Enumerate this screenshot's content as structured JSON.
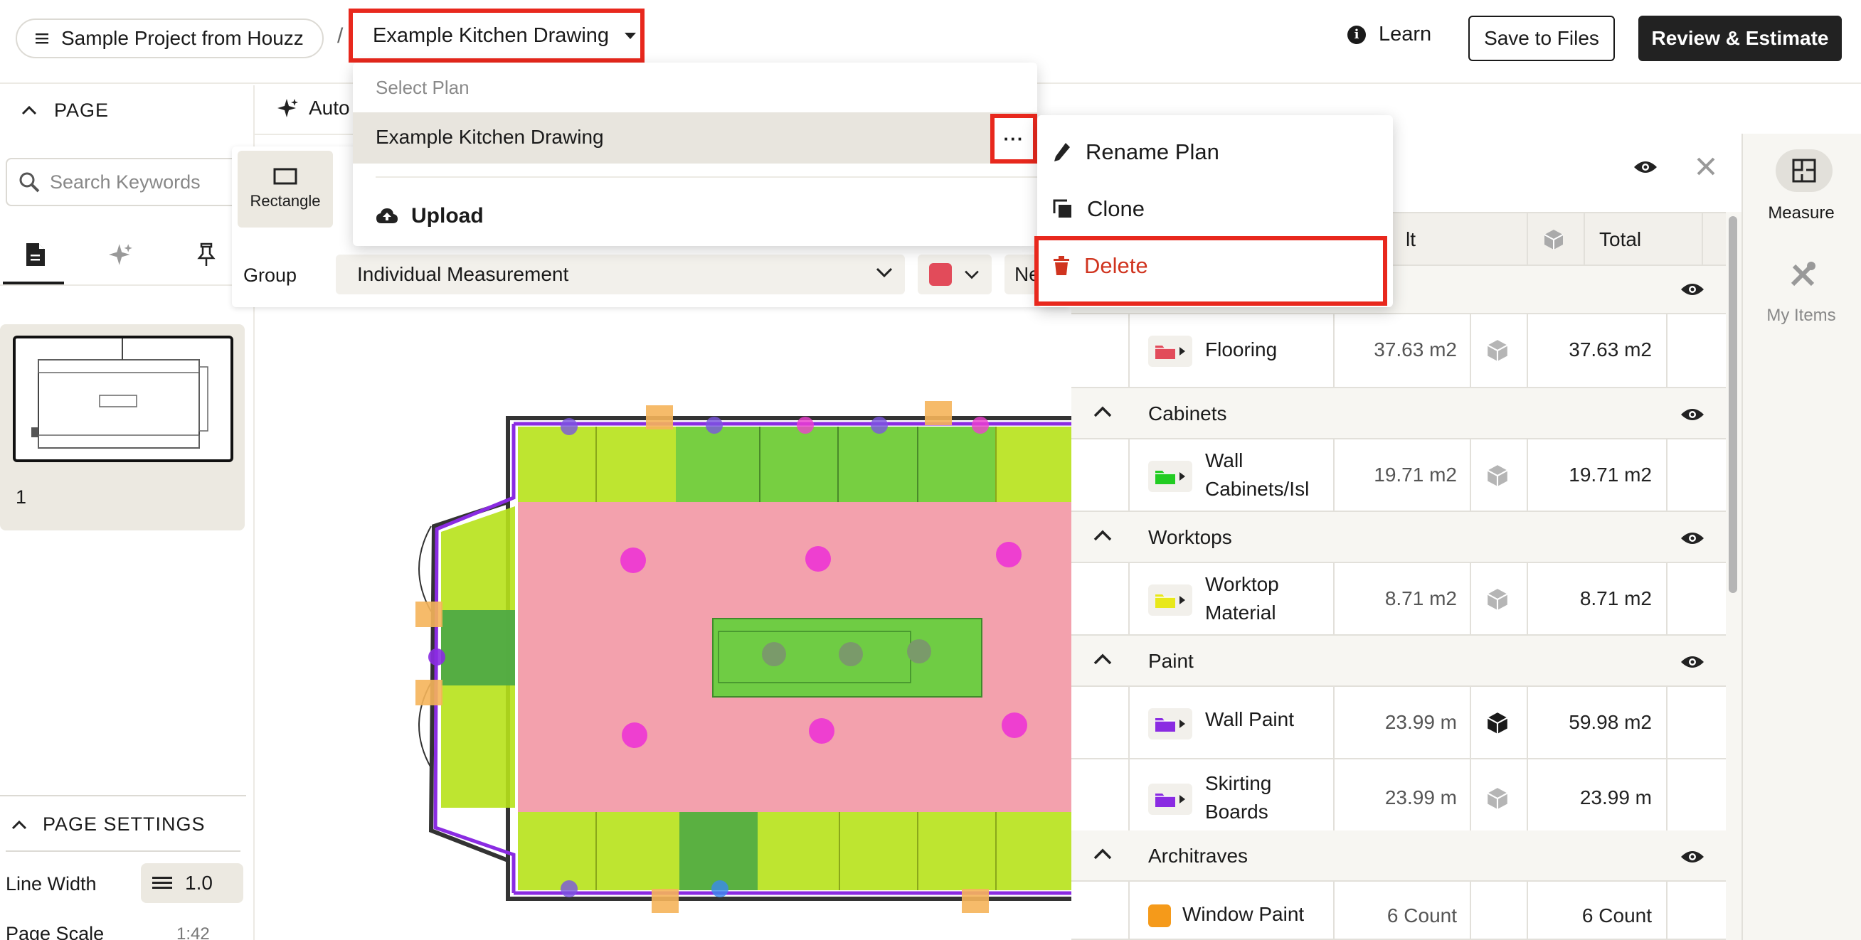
{
  "breadcrumb": {
    "project_label": "Sample Project from Houzz",
    "separator": "/",
    "plan_label": "Example Kitchen Drawing"
  },
  "header": {
    "learn_label": "Learn",
    "save_label": "Save to Files",
    "review_label": "Review & Estimate"
  },
  "page_section": {
    "title": "PAGE",
    "auto_tab_label": "Auto"
  },
  "sidebar": {
    "search_placeholder": "Search Keywords",
    "page_number": "1",
    "settings_title": "PAGE SETTINGS",
    "line_width_label": "Line Width",
    "line_width_value": "1.0",
    "page_scale_label": "Page Scale",
    "page_scale_value": "1:42"
  },
  "toolbar": {
    "rectangle_label": "Rectangle",
    "group_label": "Group",
    "group_value": "Individual Measurement",
    "group_color": "#e24b5a",
    "next_select_partial": "Ne"
  },
  "plan_dropdown": {
    "title": "Select Plan",
    "items": [
      "Example Kitchen Drawing"
    ],
    "more_label": "···",
    "upload_label": "Upload"
  },
  "context_menu": {
    "rename_label": "Rename Plan",
    "clone_label": "Clone",
    "delete_label": "Delete",
    "delete_color": "#d0341f"
  },
  "measure_panel": {
    "header_partial": "lt",
    "total_header": "Total",
    "groups": [
      {
        "name": "",
        "items": [
          {
            "name": "Flooring",
            "value": "37.63 m2",
            "total": "37.63 m2",
            "folder_color": "#e24b5a",
            "cube_active": false
          }
        ]
      },
      {
        "name": "Cabinets",
        "items": [
          {
            "name": "Wall Cabinets/Isl",
            "value": "19.71 m2",
            "total": "19.71 m2",
            "folder_color": "#22cc22",
            "cube_active": false
          }
        ]
      },
      {
        "name": "Worktops",
        "items": [
          {
            "name": "Worktop Material",
            "value": "8.71 m2",
            "total": "8.71 m2",
            "folder_color": "#e8e81a",
            "cube_active": false
          }
        ]
      },
      {
        "name": "Paint",
        "items": [
          {
            "name": "Wall Paint",
            "value": "23.99 m",
            "total": "59.98 m2",
            "folder_color": "#8a2be2",
            "cube_active": true
          },
          {
            "name": "Skirting Boards",
            "value": "23.99 m",
            "total": "23.99 m",
            "folder_color": "#8a2be2",
            "cube_active": false
          }
        ]
      },
      {
        "name": "Architraves",
        "items": [
          {
            "name": "Window Paint",
            "value": "6 Count",
            "total": "6 Count",
            "folder_color": "#f59a1a",
            "cube_active": false
          }
        ]
      }
    ]
  },
  "rail": {
    "measure_label": "Measure",
    "items_label": "My Items"
  }
}
